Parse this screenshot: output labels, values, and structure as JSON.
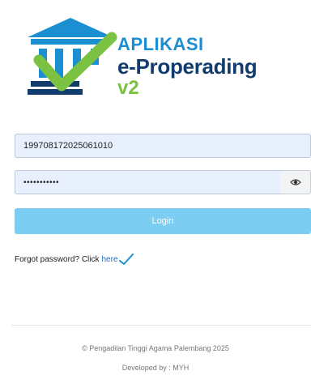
{
  "app": {
    "title_line1": "APLIKASI",
    "title_line2": "e-Properading",
    "title_line3": "v2"
  },
  "login_form": {
    "username_value": "199708172025061010",
    "password_masked": "•••••••••••",
    "toggle_icon": "eye-icon",
    "login_label": "Login",
    "forgot_text": "Forgot password? Click",
    "forgot_link": "here"
  },
  "footer": {
    "copyright": "© Pengadilan Tinggi Agama Palembang 2025",
    "developer": "Developed by : MYH"
  },
  "colors": {
    "accent_blue": "#1b8fd2",
    "navy": "#123b6e",
    "green": "#7cc242",
    "login_button": "#7ccdf2"
  }
}
